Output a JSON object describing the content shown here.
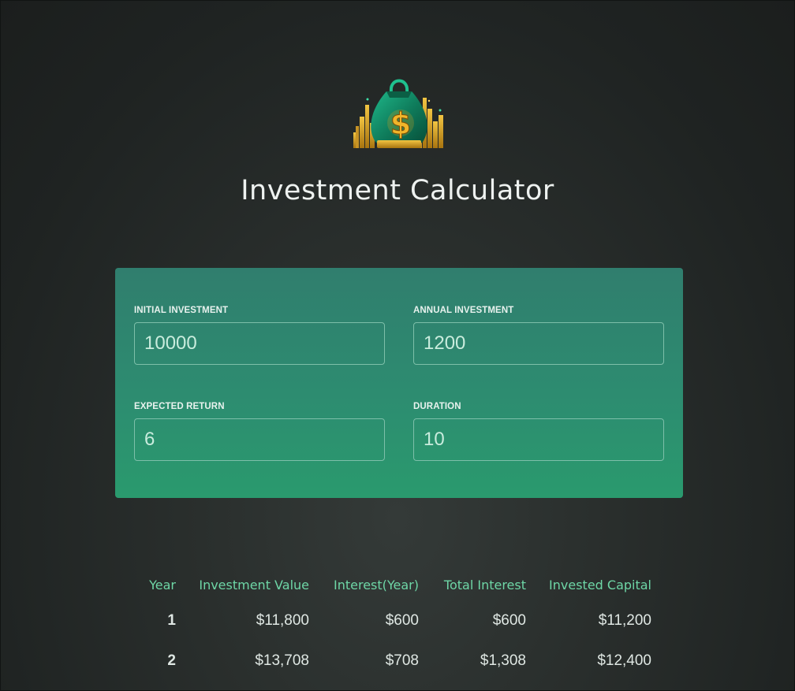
{
  "header": {
    "title": "Investment Calculator",
    "logo_icon": "money-bag-icon"
  },
  "user_input": {
    "initial_investment": {
      "label": "Initial Investment",
      "value": "10000"
    },
    "annual_investment": {
      "label": "Annual Investment",
      "value": "1200"
    },
    "expected_return": {
      "label": "Expected Return",
      "value": "6"
    },
    "duration": {
      "label": "Duration",
      "value": "10"
    }
  },
  "results": {
    "headers": [
      "Year",
      "Investment Value",
      "Interest(Year)",
      "Total Interest",
      "Invested Capital"
    ],
    "rows": [
      [
        "1",
        "$11,800",
        "$600",
        "$600",
        "$11,200"
      ],
      [
        "2",
        "$13,708",
        "$708",
        "$1,308",
        "$12,400"
      ]
    ]
  },
  "colors": {
    "background": "#2a2f2d",
    "panel_top": "#307e6e",
    "panel_bottom": "#2a9a6e",
    "header_accent": "#6ed6a6",
    "input_text": "#c9ecdd"
  }
}
